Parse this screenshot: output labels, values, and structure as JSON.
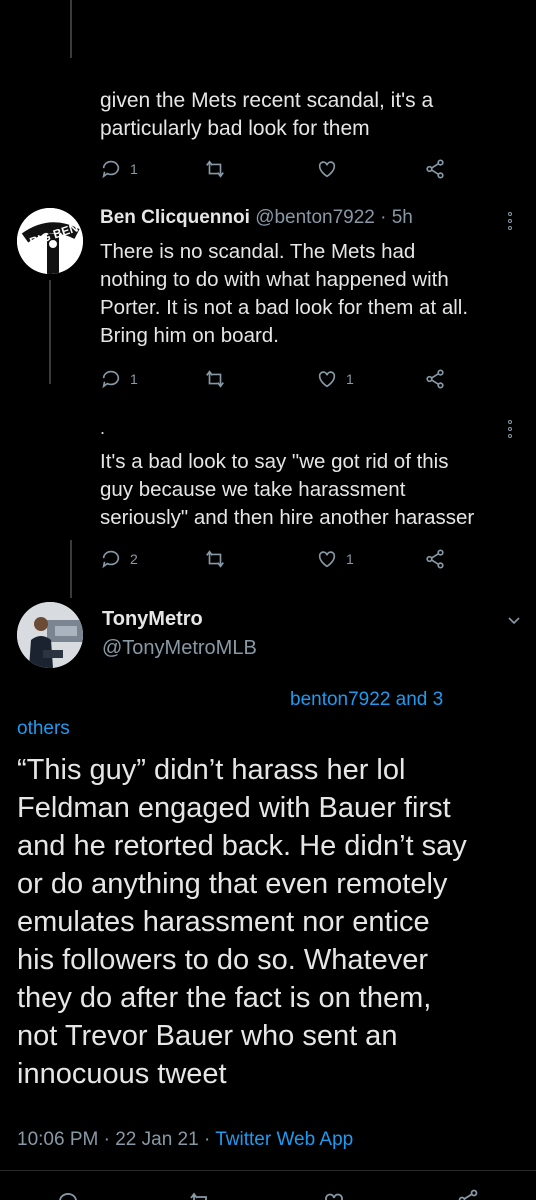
{
  "tweet1": {
    "partial_top": "· · · · · ·",
    "text_lines": [
      "given the Mets recent scandal, it's a",
      "particularly bad look for them"
    ],
    "reply_count": "1",
    "like_count": ""
  },
  "tweet2": {
    "name": "Ben Clicquennoi",
    "handle_time": "@benton7922 · 5h",
    "text_lines": [
      "There is no scandal.  The Mets had",
      "nothing to do with what happened with",
      "Porter.  It is not a bad look for them at all.",
      "Bring him on board."
    ],
    "reply_count": "1",
    "like_count": "1",
    "avatar_label": "BIG BEN"
  },
  "tweet3": {
    "dot": ".",
    "text_lines": [
      "It's a bad look to say \"we got rid of this",
      "guy because we take harassment",
      "seriously\" and then hire another harasser"
    ],
    "reply_count": "2",
    "like_count": "1"
  },
  "main_tweet": {
    "name": "TonyMetro",
    "handle": "@TonyMetroMLB",
    "replying_to_a": "benton7922 and 3",
    "replying_to_b": "others",
    "text_lines": [
      "“This guy” didn’t harass her lol",
      "Feldman engaged with Bauer first",
      "and he retorted back. He didn’t say",
      "or do anything that even remotely",
      "emulates harassment nor entice",
      "his followers to do so. Whatever",
      "they do after the fact is on them,",
      "not Trevor Bauer who sent an",
      "innocuous tweet"
    ],
    "timestamp": "10:06 PM · 22 Jan 21 · ",
    "source": "Twitter Web App"
  },
  "colors": {
    "background": "#000000",
    "muted": "#8899a6",
    "link": "#1d9bf0"
  }
}
